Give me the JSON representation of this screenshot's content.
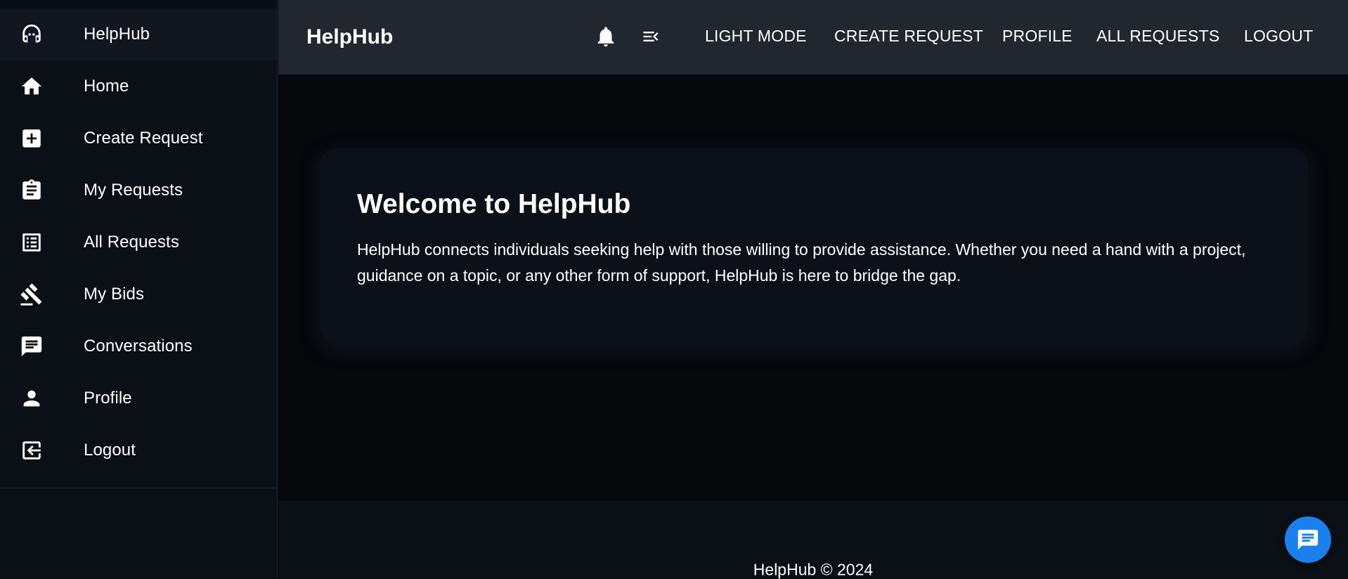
{
  "sidebar": {
    "items": [
      {
        "label": "HelpHub",
        "icon": "headset-icon"
      },
      {
        "label": "Home",
        "icon": "home-icon"
      },
      {
        "label": "Create Request",
        "icon": "add-box-icon"
      },
      {
        "label": "My Requests",
        "icon": "clipboard-icon"
      },
      {
        "label": "All Requests",
        "icon": "list-icon"
      },
      {
        "label": "My Bids",
        "icon": "gavel-icon"
      },
      {
        "label": "Conversations",
        "icon": "chat-icon"
      },
      {
        "label": "Profile",
        "icon": "person-icon"
      },
      {
        "label": "Logout",
        "icon": "logout-icon"
      }
    ]
  },
  "header": {
    "title": "HelpHub",
    "icons": [
      "bell-icon",
      "menu-collapse-icon"
    ],
    "nav": {
      "light_mode": "LIGHT MODE",
      "create_request": "CREATE REQUEST",
      "profile": "PROFILE",
      "all_requests": "ALL REQUESTS",
      "logout": "LOGOUT"
    }
  },
  "main": {
    "welcome_title": "Welcome to HelpHub",
    "welcome_text": "HelpHub connects individuals seeking help with those willing to provide assistance. Whether you need a hand with a project, guidance on a topic, or any other form of support, HelpHub is here to bridge the gap."
  },
  "footer": {
    "text": "HelpHub © 2024"
  },
  "chat_button": {
    "icon": "chat-icon"
  },
  "colors": {
    "sidebar_bg": "#0b0f16",
    "topbar_bg": "#22262f",
    "main_bg": "#06080c",
    "card_bg": "#0c1119",
    "accent": "#1a80f0"
  }
}
